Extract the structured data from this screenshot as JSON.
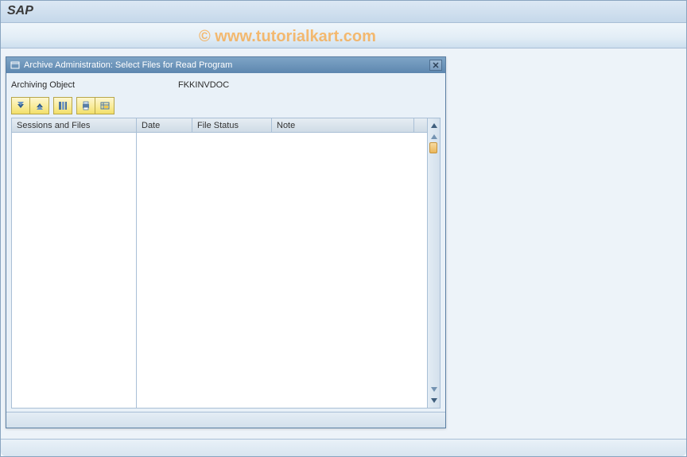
{
  "app": {
    "title": "SAP"
  },
  "watermark": {
    "text": "© www.tutorialkart.com"
  },
  "dialog": {
    "title": "Archive Administration: Select Files for Read Program",
    "field_label": "Archiving Object",
    "field_value": "FKKINVDOC",
    "toolbar": {
      "btn1": "expand-all-icon",
      "btn2": "collapse-all-icon",
      "btn3": "column-config-icon",
      "btn4": "print-icon",
      "btn5": "layout-icon"
    },
    "columns": {
      "left": "Sessions and Files",
      "c1": "Date",
      "c2": "File Status",
      "c3": "Note"
    }
  }
}
